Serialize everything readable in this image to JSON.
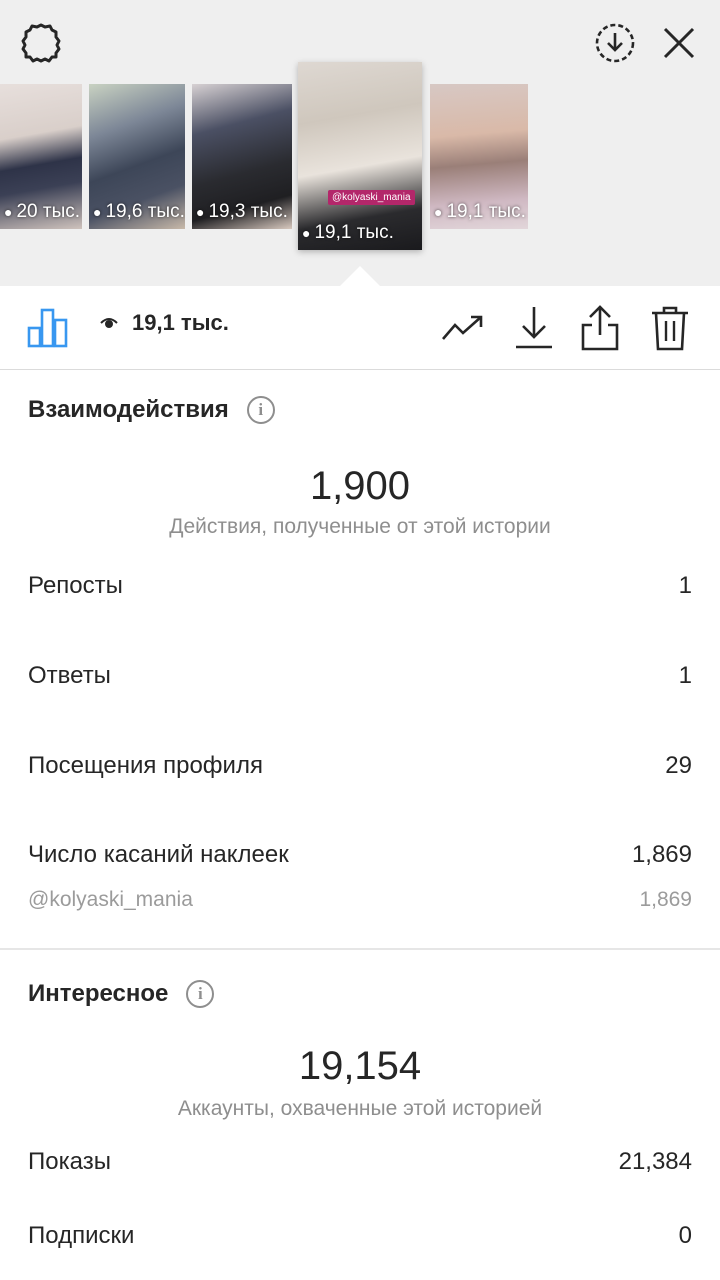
{
  "tray": {
    "thumbnails": [
      {
        "views": "20 тыс."
      },
      {
        "views": "19,6 тыс."
      },
      {
        "views": "19,3 тыс."
      },
      {
        "views": "19,1 тыс.",
        "mention_tag": "@kolyaski_mania"
      },
      {
        "views": "19,1 тыс."
      }
    ]
  },
  "toolbar": {
    "views_total": "19,1 тыс."
  },
  "interactions": {
    "title": "Взаимодействия",
    "total": "1,900",
    "caption": "Действия, полученные от этой истории",
    "rows": [
      {
        "label": "Репосты",
        "value": "1"
      },
      {
        "label": "Ответы",
        "value": "1"
      },
      {
        "label": "Посещения профиля",
        "value": "29"
      },
      {
        "label": "Число касаний наклеек",
        "value": "1,869"
      }
    ],
    "sticker_detail": {
      "label": "@kolyaski_mania",
      "value": "1,869"
    }
  },
  "discovery": {
    "title": "Интересное",
    "total": "19,154",
    "caption": "Аккаунты, охваченные этой историей",
    "rows": [
      {
        "label": "Показы",
        "value": "21,384"
      },
      {
        "label": "Подписки",
        "value": "0"
      }
    ]
  },
  "colors": {
    "accent_blue": "#3897f0",
    "text": "#262626",
    "secondary_text": "#8e8e8e",
    "tray_background": "#efefef"
  }
}
